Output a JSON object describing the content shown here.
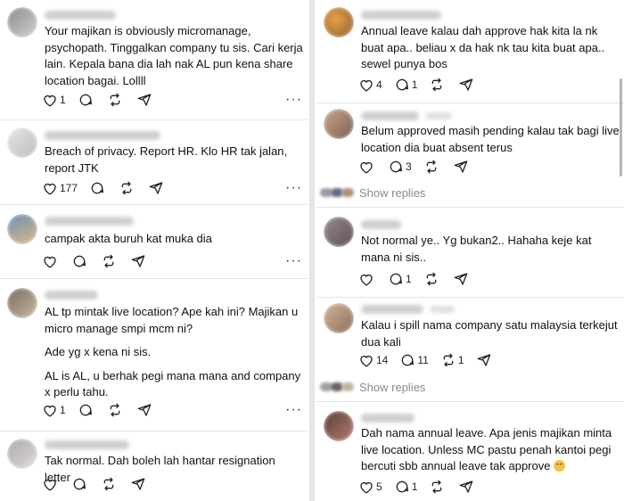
{
  "left": [
    {
      "id": "c1",
      "paragraphs": [
        "Your majikan is obviously micromanage, psychopath. Tinggalkan company tu sis. Cari kerja lain. Kepala bana dia lah nak AL pun kena share location bagai. Lollll"
      ],
      "likes": "1",
      "replies": "",
      "reposts": ""
    },
    {
      "id": "c2",
      "paragraphs": [
        "Breach of privacy. Report HR. Klo HR tak jalan, report JTK"
      ],
      "likes": "177",
      "replies": "",
      "reposts": ""
    },
    {
      "id": "c3",
      "paragraphs": [
        "campak akta buruh kat muka dia"
      ],
      "likes": "",
      "replies": "",
      "reposts": ""
    },
    {
      "id": "c4",
      "paragraphs": [
        "AL tp mintak live location? Ape kah ini? Majikan u micro manage smpi mcm ni?",
        "Ade yg x kena ni sis.",
        "AL is AL, u berhak pegi mana mana and company x perlu tahu."
      ],
      "likes": "1",
      "replies": "",
      "reposts": ""
    },
    {
      "id": "c5",
      "paragraphs": [
        "Tak normal. Dah boleh lah hantar resignation letter"
      ],
      "likes": "",
      "replies": "",
      "reposts": ""
    }
  ],
  "right": [
    {
      "id": "r1",
      "paragraphs": [
        "Annual leave kalau dah approve hak kita la nk buat apa.. beliau x da hak nk tau kita buat apa.. sewel punya bos"
      ],
      "likes": "4",
      "replies": "1",
      "reposts": ""
    },
    {
      "id": "r2",
      "paragraphs": [
        "Belum approved masih pending kalau tak bagi live location dia buat absent terus"
      ],
      "likes": "",
      "replies": "3",
      "reposts": ""
    },
    {
      "id": "r3",
      "paragraphs": [
        "Not normal ye.. Yg bukan2.. Hahaha keje kat mana ni sis.."
      ],
      "likes": "",
      "replies": "1",
      "reposts": ""
    },
    {
      "id": "r4",
      "paragraphs": [
        "Kalau i spill nama company satu malaysia terkejut dua kali"
      ],
      "likes": "14",
      "replies": "11",
      "reposts": "1"
    },
    {
      "id": "r5",
      "paragraphs": [
        "Dah nama annual leave. Apa jenis majikan minta live location. Unless MC pastu penah kantoi pegi bercuti sbb annual leave tak approve"
      ],
      "emoji": "grinning-sweat-emoji",
      "likes": "5",
      "replies": "1",
      "reposts": ""
    }
  ],
  "show_replies_label": "Show replies",
  "more_label": "···",
  "icons": {
    "like": "heart-icon",
    "reply": "comment-icon",
    "repost": "repost-icon",
    "share": "send-icon",
    "more": "more-icon"
  },
  "colors": {
    "text": "#111111",
    "muted": "#8a8a8a",
    "separator": "#e4e4e4"
  }
}
